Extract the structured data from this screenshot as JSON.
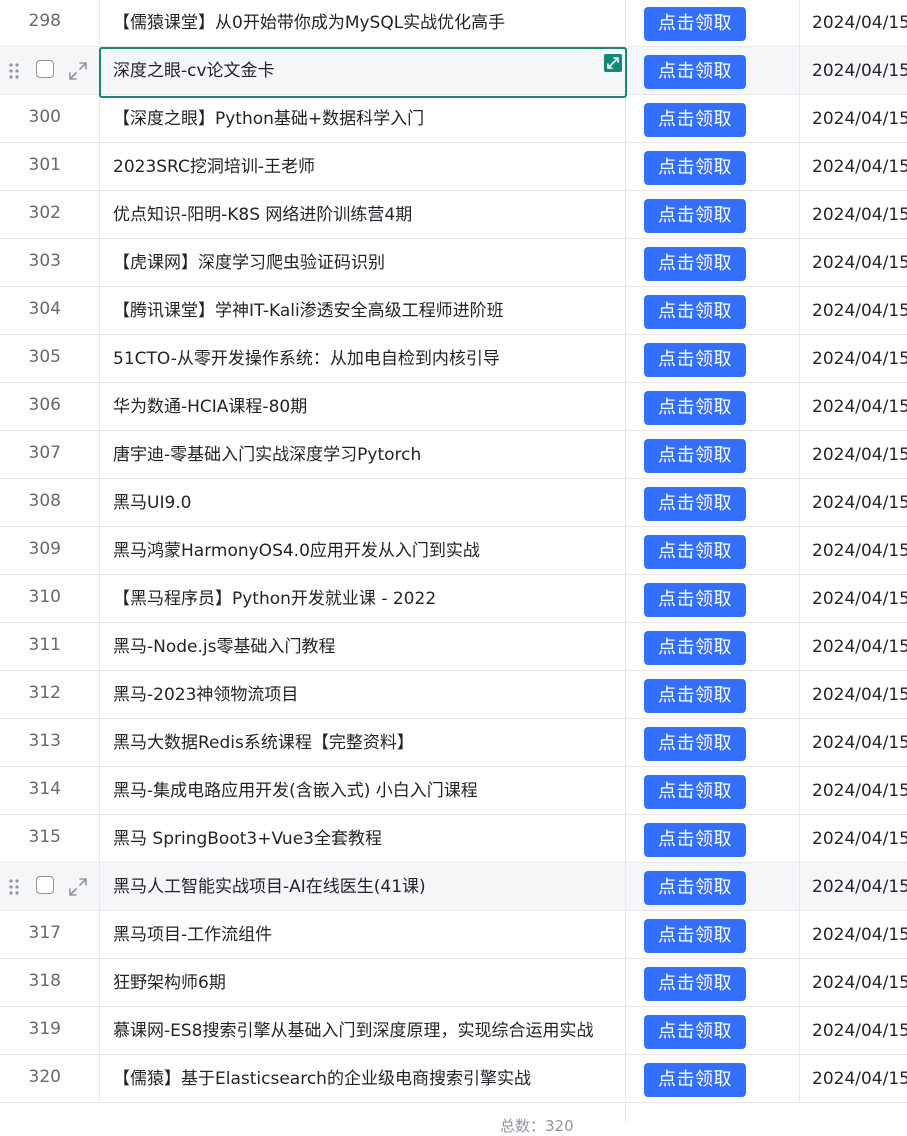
{
  "button_label": "点击领取",
  "rows": [
    {
      "num": "298",
      "name": "【儒猿课堂】从0开始带你成为MySQL实战优化高手",
      "date": "2024/04/15"
    },
    {
      "num": "",
      "name": "深度之眼-cv论文金卡",
      "date": "2024/04/15",
      "state": "selected"
    },
    {
      "num": "300",
      "name": "【深度之眼】Python基础+数据科学入门",
      "date": "2024/04/15"
    },
    {
      "num": "301",
      "name": "2023SRC挖洞培训-王老师",
      "date": "2024/04/15"
    },
    {
      "num": "302",
      "name": "优点知识-阳明-K8S 网络进阶训练营4期",
      "date": "2024/04/15"
    },
    {
      "num": "303",
      "name": "【虎课网】深度学习爬虫验证码识别",
      "date": "2024/04/15"
    },
    {
      "num": "304",
      "name": "【腾讯课堂】学神IT-Kali渗透安全高级工程师进阶班",
      "date": "2024/04/15"
    },
    {
      "num": "305",
      "name": "51CTO-从零开发操作系统：从加电自检到内核引导",
      "date": "2024/04/15"
    },
    {
      "num": "306",
      "name": "华为数通-HCIA课程-80期",
      "date": "2024/04/15"
    },
    {
      "num": "307",
      "name": "唐宇迪-零基础入门实战深度学习Pytorch",
      "date": "2024/04/15"
    },
    {
      "num": "308",
      "name": "黑马UI9.0",
      "date": "2024/04/15"
    },
    {
      "num": "309",
      "name": "黑马鸿蒙HarmonyOS4.0应用开发从入门到实战",
      "date": "2024/04/15"
    },
    {
      "num": "310",
      "name": "【黑马程序员】Python开发就业课 - 2022",
      "date": "2024/04/15"
    },
    {
      "num": "311",
      "name": "黑马-Node.js零基础入门教程",
      "date": "2024/04/15"
    },
    {
      "num": "312",
      "name": "黑马-2023神领物流项目",
      "date": "2024/04/15"
    },
    {
      "num": "313",
      "name": "黑马大数据Redis系统课程【完整资料】",
      "date": "2024/04/15"
    },
    {
      "num": "314",
      "name": "黑马-集成电路应用开发(含嵌入式) 小白入门课程",
      "date": "2024/04/15"
    },
    {
      "num": "315",
      "name": "黑马 SpringBoot3+Vue3全套教程",
      "date": "2024/04/15"
    },
    {
      "num": "",
      "name": "黑马人工智能实战项目-AI在线医生(41课)",
      "date": "2024/04/15",
      "state": "hover"
    },
    {
      "num": "317",
      "name": "黑马项目-工作流组件",
      "date": "2024/04/15"
    },
    {
      "num": "318",
      "name": "狂野架构师6期",
      "date": "2024/04/15"
    },
    {
      "num": "319",
      "name": "慕课网-ES8搜索引擎从基础入门到深度原理，实现综合运用实战",
      "date": "2024/04/15"
    },
    {
      "num": "320",
      "name": "【儒猿】基于Elasticsearch的企业级电商搜索引擎实战",
      "date": "2024/04/15"
    }
  ],
  "footer_text": "总数：320"
}
